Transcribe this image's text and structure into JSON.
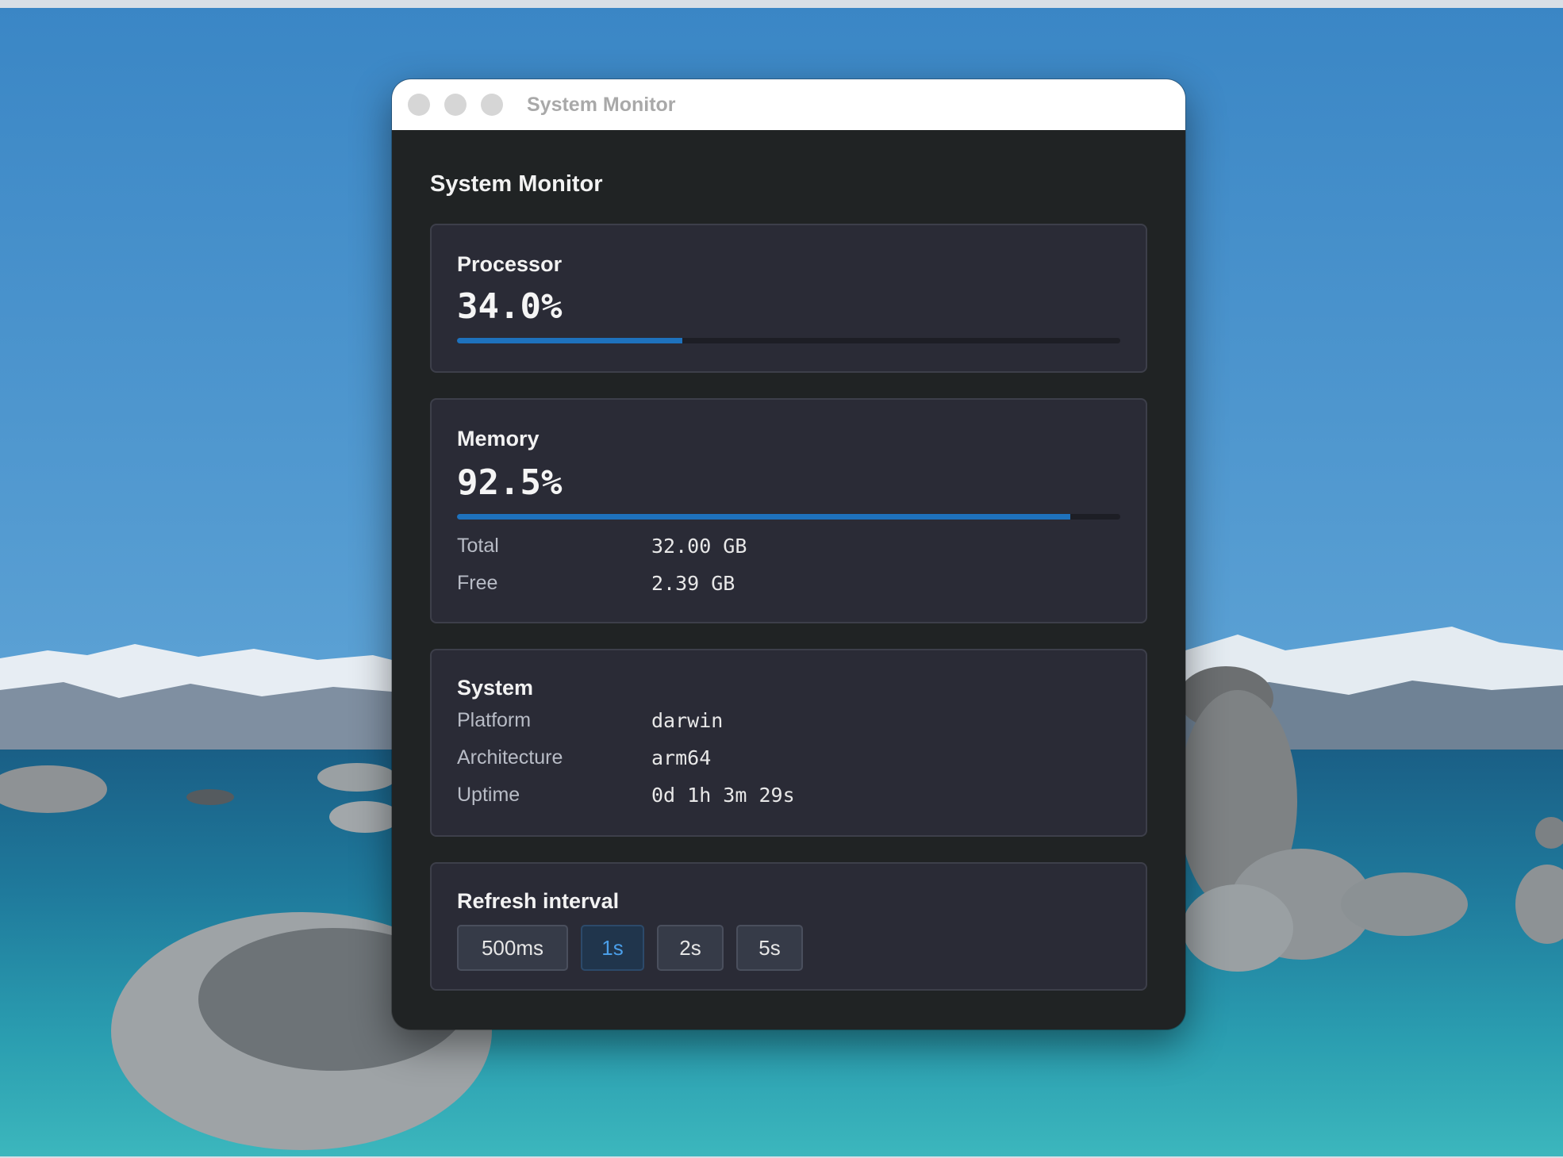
{
  "window": {
    "title": "System Monitor"
  },
  "app": {
    "title": "System Monitor"
  },
  "processor": {
    "title": "Processor",
    "value_text": "34.0%",
    "percent": 34.0
  },
  "memory": {
    "title": "Memory",
    "value_text": "92.5%",
    "percent": 92.5,
    "rows": [
      {
        "label": "Total",
        "value": "32.00 GB"
      },
      {
        "label": "Free",
        "value": "2.39 GB"
      }
    ]
  },
  "system": {
    "title": "System",
    "rows": [
      {
        "label": "Platform",
        "value": "darwin"
      },
      {
        "label": "Architecture",
        "value": "arm64"
      },
      {
        "label": "Uptime",
        "value": "0d 1h 3m 29s"
      }
    ]
  },
  "refresh": {
    "title": "Refresh interval",
    "options": [
      "500ms",
      "1s",
      "2s",
      "5s"
    ],
    "selected": "1s"
  },
  "colors": {
    "accent": "#1e72bd",
    "active_text": "#4a9ee8",
    "window_bg": "#202324",
    "card_bg": "#2a2b36"
  }
}
